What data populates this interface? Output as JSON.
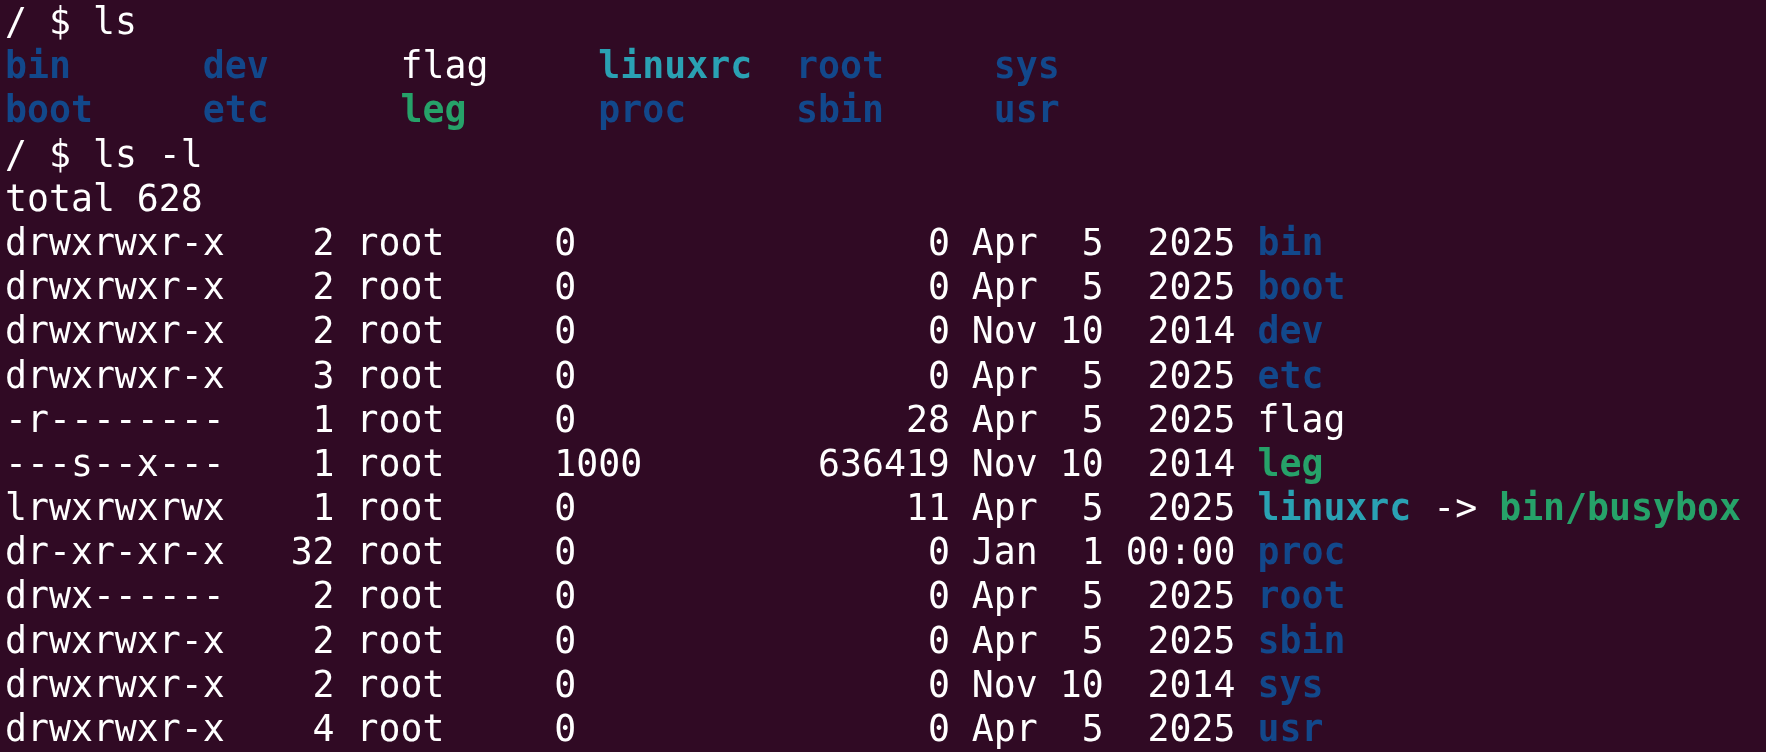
{
  "terminal": {
    "blocks": [
      {
        "kind": "prompt",
        "prompt": "/ $",
        "command": "ls"
      },
      {
        "kind": "grid",
        "rows": [
          [
            {
              "name": "bin",
              "kind": "dir"
            },
            {
              "name": "dev",
              "kind": "dir"
            },
            {
              "name": "flag",
              "kind": "plain"
            },
            {
              "name": "linuxrc",
              "kind": "link"
            },
            {
              "name": "root",
              "kind": "dir"
            },
            {
              "name": "sys",
              "kind": "dir"
            }
          ],
          [
            {
              "name": "boot",
              "kind": "dir"
            },
            {
              "name": "etc",
              "kind": "dir"
            },
            {
              "name": "leg",
              "kind": "exec"
            },
            {
              "name": "proc",
              "kind": "dir"
            },
            {
              "name": "sbin",
              "kind": "dir"
            },
            {
              "name": "usr",
              "kind": "dir"
            }
          ]
        ]
      },
      {
        "kind": "prompt",
        "prompt": "/ $",
        "command": "ls -l"
      },
      {
        "kind": "text",
        "text": "total 628"
      },
      {
        "kind": "long",
        "entries": [
          {
            "perms": "drwxrwxr-x",
            "links": "2",
            "owner": "root",
            "group": "0",
            "size": "0",
            "month": "Apr",
            "day": "5",
            "year": "2025",
            "name": {
              "text": "bin",
              "kind": "dir"
            }
          },
          {
            "perms": "drwxrwxr-x",
            "links": "2",
            "owner": "root",
            "group": "0",
            "size": "0",
            "month": "Apr",
            "day": "5",
            "year": "2025",
            "name": {
              "text": "boot",
              "kind": "dir"
            }
          },
          {
            "perms": "drwxrwxr-x",
            "links": "2",
            "owner": "root",
            "group": "0",
            "size": "0",
            "month": "Nov",
            "day": "10",
            "year": "2014",
            "name": {
              "text": "dev",
              "kind": "dir"
            }
          },
          {
            "perms": "drwxrwxr-x",
            "links": "3",
            "owner": "root",
            "group": "0",
            "size": "0",
            "month": "Apr",
            "day": "5",
            "year": "2025",
            "name": {
              "text": "etc",
              "kind": "dir"
            }
          },
          {
            "perms": "-r--------",
            "links": "1",
            "owner": "root",
            "group": "0",
            "size": "28",
            "month": "Apr",
            "day": "5",
            "year": "2025",
            "name": {
              "text": "flag",
              "kind": "plain"
            }
          },
          {
            "perms": "---s--x---",
            "links": "1",
            "owner": "root",
            "group": "1000",
            "size": "636419",
            "month": "Nov",
            "day": "10",
            "year": "2014",
            "name": {
              "text": "leg",
              "kind": "exec"
            }
          },
          {
            "perms": "lrwxrwxrwx",
            "links": "1",
            "owner": "root",
            "group": "0",
            "size": "11",
            "month": "Apr",
            "day": "5",
            "year": "2025",
            "name": {
              "text": "linuxrc",
              "kind": "link"
            },
            "arrow": "->",
            "target": {
              "text": "bin/busybox",
              "kind": "exec"
            }
          },
          {
            "perms": "dr-xr-xr-x",
            "links": "32",
            "owner": "root",
            "group": "0",
            "size": "0",
            "month": "Jan",
            "day": "1",
            "year": "00:00",
            "name": {
              "text": "proc",
              "kind": "dir"
            }
          },
          {
            "perms": "drwx------",
            "links": "2",
            "owner": "root",
            "group": "0",
            "size": "0",
            "month": "Apr",
            "day": "5",
            "year": "2025",
            "name": {
              "text": "root",
              "kind": "dir"
            }
          },
          {
            "perms": "drwxrwxr-x",
            "links": "2",
            "owner": "root",
            "group": "0",
            "size": "0",
            "month": "Apr",
            "day": "5",
            "year": "2025",
            "name": {
              "text": "sbin",
              "kind": "dir"
            }
          },
          {
            "perms": "drwxrwxr-x",
            "links": "2",
            "owner": "root",
            "group": "0",
            "size": "0",
            "month": "Nov",
            "day": "10",
            "year": "2014",
            "name": {
              "text": "sys",
              "kind": "dir"
            }
          },
          {
            "perms": "drwxrwxr-x",
            "links": "4",
            "owner": "root",
            "group": "0",
            "size": "0",
            "month": "Apr",
            "day": "5",
            "year": "2025",
            "name": {
              "text": "usr",
              "kind": "dir"
            }
          }
        ]
      }
    ]
  }
}
